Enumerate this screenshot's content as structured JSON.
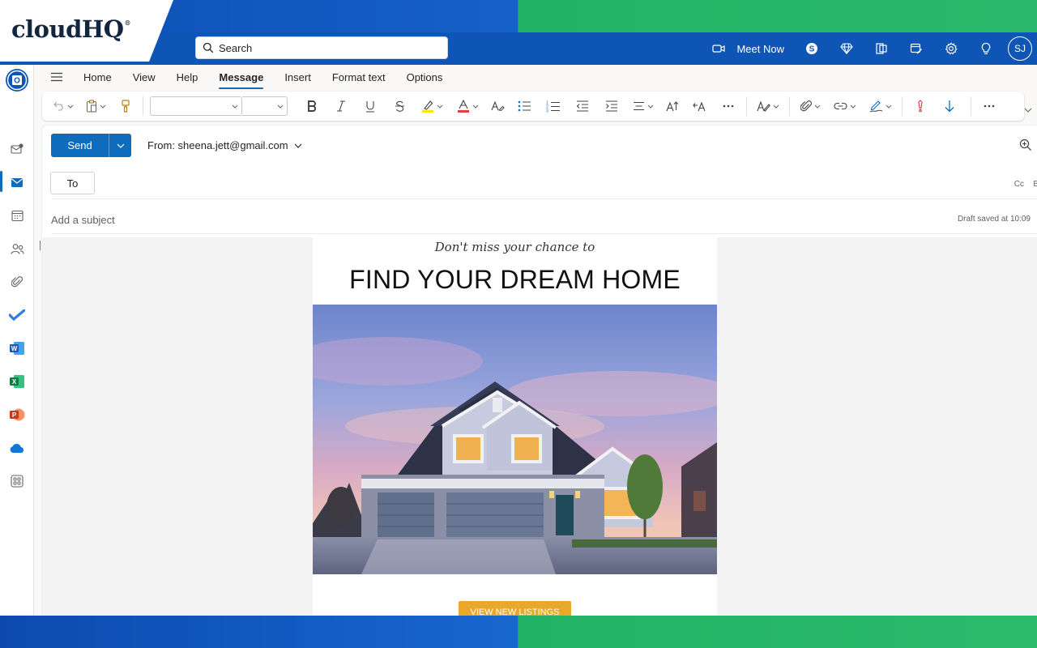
{
  "brand": {
    "logo_text": "cloudHQ",
    "logo_mark": "®"
  },
  "appbar": {
    "search_placeholder": "Search",
    "meet_now_label": "Meet Now",
    "avatar_initials": "SJ",
    "icons": [
      "video-icon",
      "skype-icon",
      "diamond-icon",
      "office-icon",
      "calendar-edit-icon",
      "gear-icon",
      "lightbulb-icon"
    ]
  },
  "rail": {
    "items": [
      "outlook-app",
      "mail-add",
      "mail",
      "calendar",
      "people",
      "attach",
      "todo",
      "word",
      "excel",
      "powerpoint",
      "onedrive",
      "more-apps"
    ]
  },
  "ribbon": {
    "tabs": [
      "Home",
      "View",
      "Help",
      "Message",
      "Insert",
      "Format text",
      "Options"
    ],
    "active_tab": "Message"
  },
  "compose": {
    "send_label": "Send",
    "from_label": "From: sheena.jett@gmail.com",
    "to_label": "To",
    "cc_label": "Cc",
    "bcc_label": "B",
    "subject_placeholder": "Add a subject",
    "draft_status": "Draft saved at 10:09"
  },
  "email": {
    "tagline": "Don't miss your chance to",
    "headline": "FIND YOUR DREAM HOME",
    "cta_label": "VIEW NEW LISTINGS"
  },
  "colors": {
    "brand_blue": "#0f55b5",
    "brand_green": "#21b466",
    "accent": "#0f6cbd",
    "cta": "#e8a82a"
  }
}
